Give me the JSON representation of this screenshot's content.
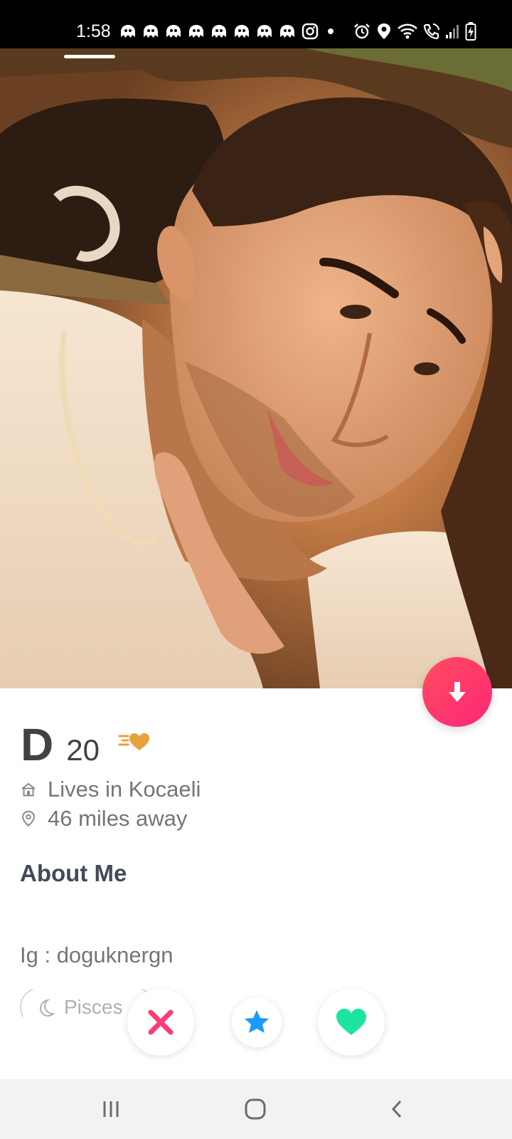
{
  "status_bar": {
    "time": "1:58",
    "notification_icons": [
      "messenger-ghost-icon",
      "messenger-ghost-icon",
      "messenger-ghost-icon",
      "messenger-ghost-icon",
      "messenger-ghost-icon",
      "messenger-ghost-icon",
      "messenger-ghost-icon",
      "messenger-ghost-icon",
      "instagram-icon",
      "dot-icon"
    ],
    "system_icons": [
      "alarm-icon",
      "location-icon",
      "wifi-icon",
      "wifi-call-icon",
      "signal-icon",
      "battery-charging-icon"
    ]
  },
  "photo": {
    "indicator_count": 1,
    "active_index": 1
  },
  "profile": {
    "name": "D",
    "age": "20",
    "lives_in": "Lives in Kocaeli",
    "distance": "46 miles away"
  },
  "about": {
    "title": "About Me",
    "bio": "Ig : doguknergn"
  },
  "chips": [
    {
      "label": "Pisces",
      "icon": "moon-icon"
    }
  ],
  "actions": [
    "nope-icon",
    "star-icon",
    "heart-icon"
  ],
  "colors": {
    "brand_gradient_start": "#ff4d5c",
    "brand_gradient_end": "#fd267a",
    "nope": "#fe3c72",
    "super_like": "#1a9bfc",
    "like": "#1be4a1",
    "super_swipe_gold": "#e6a23c"
  }
}
